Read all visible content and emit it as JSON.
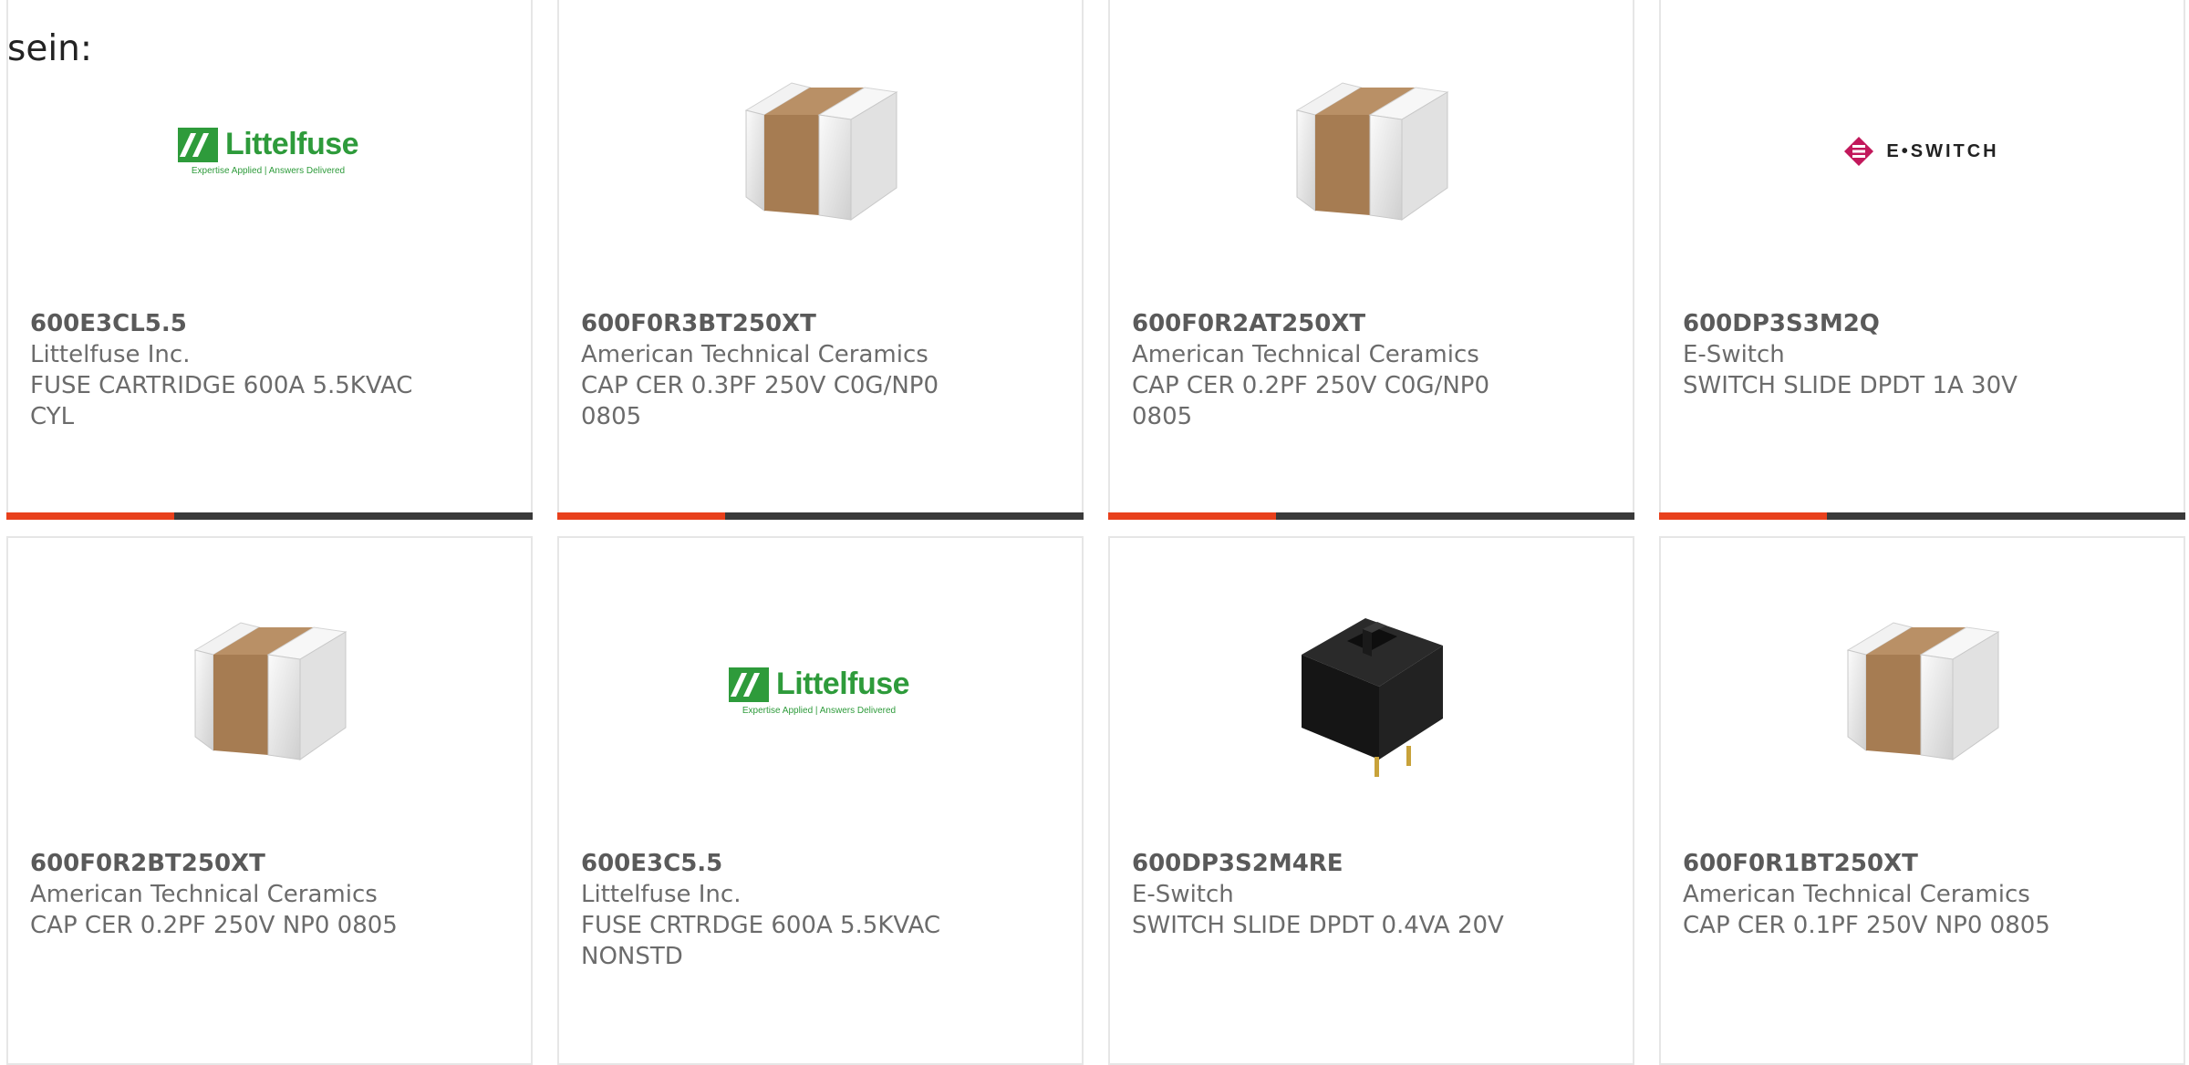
{
  "intro_text": "sein:",
  "colors": {
    "accent": "#e8401c",
    "bar": "#3a3a3a",
    "littelfuse_green": "#2e9b3b",
    "eswitch_magenta": "#c2185b"
  },
  "logos": {
    "littelfuse": {
      "name": "Littelfuse",
      "tagline": "Expertise Applied | Answers Delivered"
    },
    "eswitch": {
      "name": "E•SWITCH"
    }
  },
  "products": [
    {
      "part_number": "600E3CL5.5",
      "manufacturer": "Littelfuse Inc.",
      "description": "FUSE CARTRIDGE 600A 5.5KVAC CYL",
      "image": "littelfuse-logo"
    },
    {
      "part_number": "600F0R3BT250XT",
      "manufacturer": "American Technical Ceramics",
      "description": "CAP CER 0.3PF 250V C0G/NP0 0805",
      "image": "ceramic-capacitor"
    },
    {
      "part_number": "600F0R2AT250XT",
      "manufacturer": "American Technical Ceramics",
      "description": "CAP CER 0.2PF 250V C0G/NP0 0805",
      "image": "ceramic-capacitor"
    },
    {
      "part_number": "600DP3S3M2Q",
      "manufacturer": "E-Switch",
      "description": "SWITCH SLIDE DPDT 1A 30V",
      "image": "eswitch-logo"
    },
    {
      "part_number": "600F0R2BT250XT",
      "manufacturer": "American Technical Ceramics",
      "description": "CAP CER 0.2PF 250V NP0 0805",
      "image": "ceramic-capacitor"
    },
    {
      "part_number": "600E3C5.5",
      "manufacturer": "Littelfuse Inc.",
      "description": "FUSE CRTRDGE 600A 5.5KVAC NONSTD",
      "image": "littelfuse-logo"
    },
    {
      "part_number": "600DP3S2M4RE",
      "manufacturer": "E-Switch",
      "description": "SWITCH SLIDE DPDT 0.4VA 20V",
      "image": "slide-switch"
    },
    {
      "part_number": "600F0R1BT250XT",
      "manufacturer": "American Technical Ceramics",
      "description": "CAP CER 0.1PF 250V NP0 0805",
      "image": "ceramic-capacitor"
    }
  ]
}
